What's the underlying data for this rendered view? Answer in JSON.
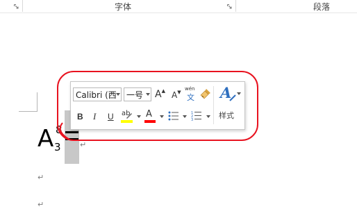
{
  "ribbon": {
    "group_font_label": "字体",
    "group_paragraph_label": "段落"
  },
  "formula": {
    "base": "A",
    "superscript": "8",
    "subscript": "3",
    "operator": "="
  },
  "paragraph_mark": "↵",
  "mini_toolbar": {
    "font_name": "Calibri (西",
    "font_size": "一号",
    "grow_font_label": "A",
    "shrink_font_label": "A",
    "phonetic_top": "wén",
    "phonetic_bottom": "文",
    "bold_label": "B",
    "italic_label": "I",
    "underline_label": "U",
    "highlight_label": "ab",
    "font_color_label": "A",
    "styles_label": "样式",
    "colors": {
      "highlight": "#ffff00",
      "font_color": "#ff0000",
      "styles_icon": "#2f6fbf",
      "annotation_ring": "#e8121f"
    }
  }
}
